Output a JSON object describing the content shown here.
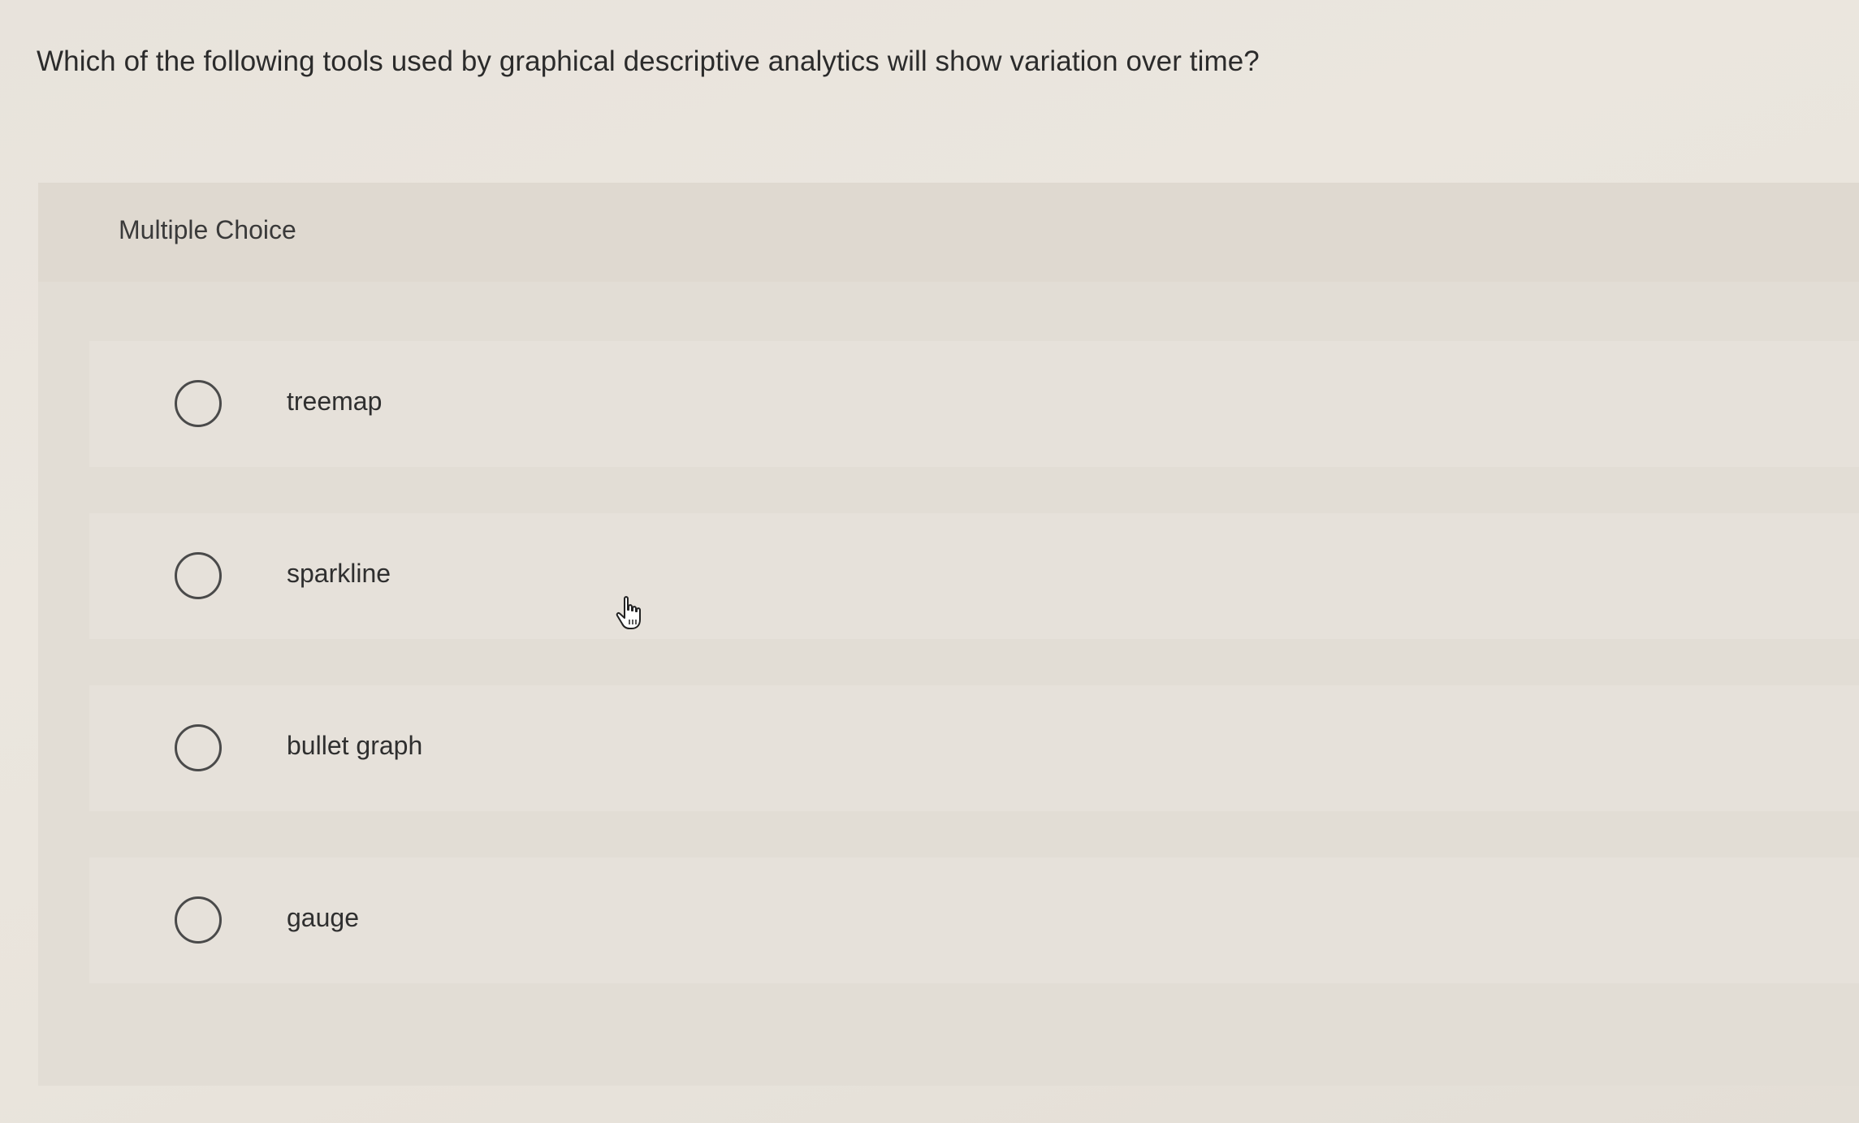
{
  "question": {
    "text": "Which of the following tools used by graphical descriptive analytics will show variation over time?"
  },
  "panel": {
    "type_label": "Multiple Choice"
  },
  "options": [
    {
      "label": "treemap",
      "selected": false
    },
    {
      "label": "sparkline",
      "selected": false
    },
    {
      "label": "bullet graph",
      "selected": false
    },
    {
      "label": "gauge",
      "selected": false
    }
  ],
  "cursor": {
    "icon": "hand-pointer-icon"
  }
}
